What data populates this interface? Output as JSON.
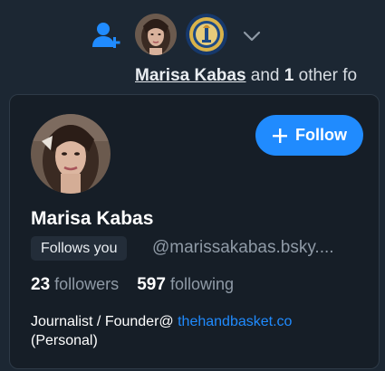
{
  "colors": {
    "background": "#1c2733",
    "card_background": "#161e27",
    "accent": "#208bfe",
    "muted_text": "#8f9aa6"
  },
  "icons": {
    "add_user": "person-plus-icon",
    "expand": "chevron-down-icon",
    "follow_plus": "plus-icon"
  },
  "notification": {
    "name": "Marisa Kabas",
    "and_text": "and",
    "count": "1",
    "other_text": "other fo"
  },
  "card": {
    "display_name": "Marisa Kabas",
    "follows_you": "Follows you",
    "handle": "@marissakabas.bsky....",
    "follow_label": "Follow",
    "followers_count": "23",
    "followers_label": "followers",
    "following_count": "597",
    "following_label": "following",
    "bio_text": "Journalist / Founder@",
    "bio_link": "thehandbasket.co",
    "bio_second_line": "(Personal)"
  }
}
